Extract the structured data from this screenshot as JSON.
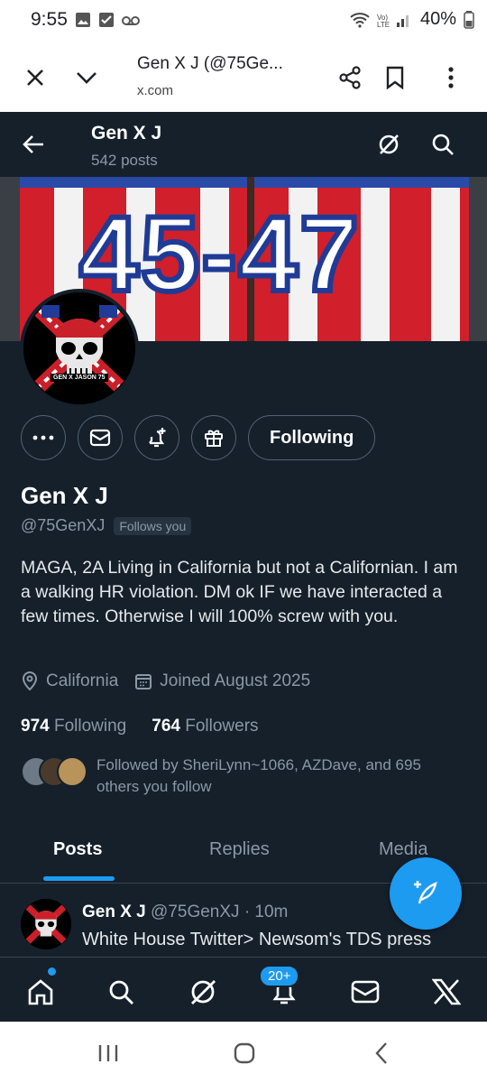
{
  "status_bar": {
    "time": "9:55",
    "battery": "40%"
  },
  "browser": {
    "title": "Gen X J (@75Ge...",
    "url": "x.com"
  },
  "header": {
    "name": "Gen X J",
    "posts_count": "542 posts"
  },
  "banner": {
    "text": "45-47"
  },
  "avatar": {
    "text": "GEN X JASON 75"
  },
  "actions": {
    "follow_label": "Following"
  },
  "profile": {
    "name": "Gen X J",
    "handle": "@75GenXJ",
    "follows_you": "Follows you",
    "bio": "MAGA, 2A Living in California but not a Californian. I am a walking HR violation. DM ok IF we have interacted a few times. Otherwise I will 100% screw with you.",
    "location": "California",
    "joined": "Joined August 2025",
    "following_count": "974",
    "following_label": "Following",
    "followers_count": "764",
    "followers_label": "Followers",
    "followed_by": "Followed by SheriLynn~1066, AZDave, and 695 others you follow"
  },
  "tabs": [
    {
      "label": "Posts"
    },
    {
      "label": "Replies"
    },
    {
      "label": "Media"
    }
  ],
  "post": {
    "name": "Gen X J",
    "meta": "@75GenXJ · 10m",
    "text": "White House Twitter> Newsom's TDS press"
  },
  "bottom_nav": {
    "notif_badge": "20+"
  },
  "colors": {
    "accent": "#1d9bf0",
    "background": "#15202b",
    "muted": "#8b98a5"
  }
}
